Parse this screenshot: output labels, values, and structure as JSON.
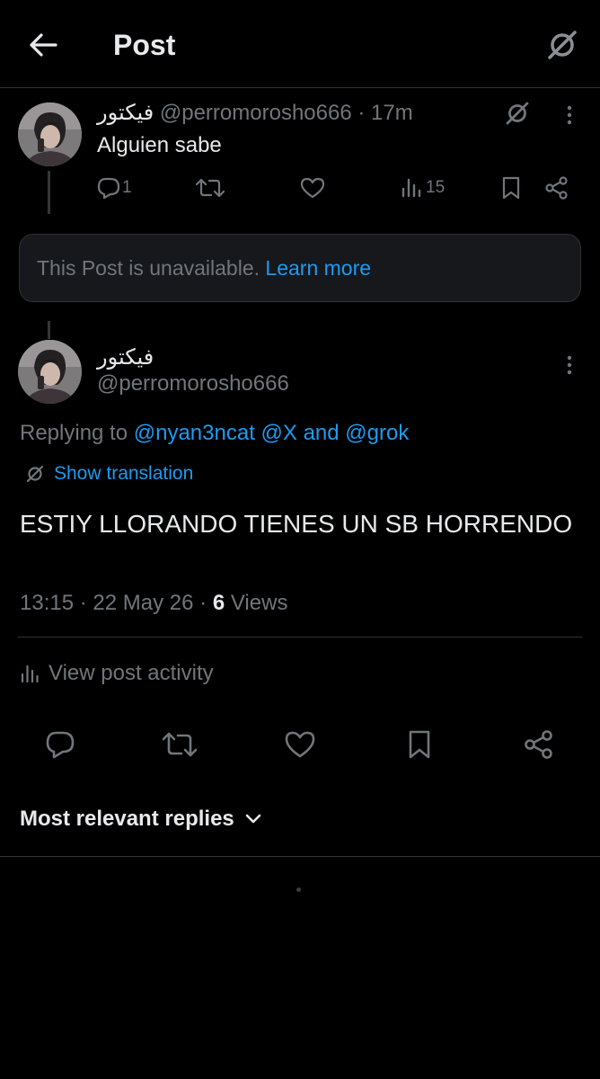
{
  "header": {
    "title": "Post"
  },
  "parent_post": {
    "display_name": "فيكتور",
    "handle": "@perromorosho666",
    "time_sep": "·",
    "time": "17m",
    "text": "Alguien sabe",
    "reply_count": "1",
    "views": "15"
  },
  "unavailable": {
    "text": "This Post is unavailable.",
    "link": "Learn more"
  },
  "main_post": {
    "display_name": "فيكتور",
    "handle": "@perromorosho666",
    "replying_prefix": "Replying to",
    "replying_handles": "@nyan3ncat @X and @grok",
    "translate_label": "Show translation",
    "text": "ESTIY LLORANDO TIENES UN SB HORRENDO",
    "time": "13:15",
    "date": "22 May 26",
    "meta_sep": "·",
    "views_count": "6",
    "views_label": "Views",
    "activity_label": "View post activity"
  },
  "replies": {
    "sort_label": "Most relevant replies"
  },
  "colors": {
    "background": "#000000",
    "accent": "#1d9bf0",
    "muted": "#71767b",
    "text": "#e7e9ea"
  },
  "icons": [
    "back-arrow-icon",
    "grok-icon",
    "more-icon",
    "reply-icon",
    "retweet-icon",
    "like-icon",
    "views-icon",
    "bookmark-icon",
    "share-icon",
    "chevron-down-icon"
  ]
}
